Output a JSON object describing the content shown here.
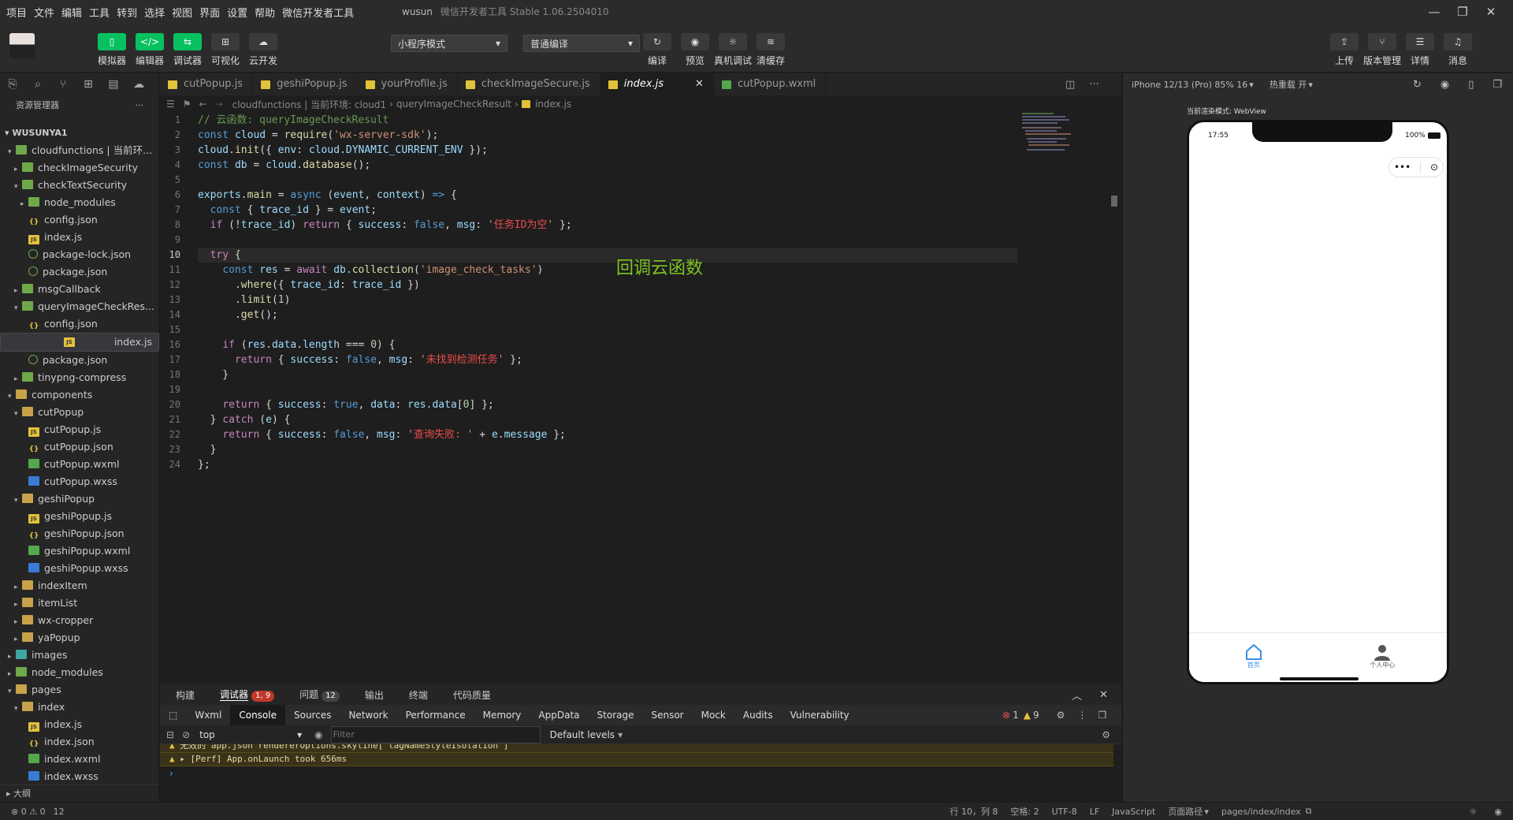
{
  "menu": [
    "项目",
    "文件",
    "编辑",
    "工具",
    "转到",
    "选择",
    "视图",
    "界面",
    "设置",
    "帮助",
    "微信开发者工具"
  ],
  "window": {
    "project": "wusun",
    "title": "微信开发者工具 Stable 1.06.2504010"
  },
  "toolbar": {
    "left": [
      "模拟器",
      "编辑器",
      "调试器",
      "可视化",
      "云开发"
    ],
    "mode_select": "小程序模式",
    "compile_select": "普通编译",
    "mid": [
      "编译",
      "预览",
      "真机调试",
      "清缓存"
    ],
    "right": [
      "上传",
      "版本管理",
      "详情",
      "消息"
    ]
  },
  "explorer": {
    "title": "资源管理器",
    "root": "WUSUNYA1",
    "outline": "大纲",
    "items": [
      {
        "label": "cloudfunctions | 当前环...",
        "icon": "folderg",
        "depth": 1,
        "arrow": "▾"
      },
      {
        "label": "checkImageSecurity",
        "icon": "folderg",
        "depth": 2,
        "arrow": "▸"
      },
      {
        "label": "checkTextSecurity",
        "icon": "folderg",
        "depth": 2,
        "arrow": "▾"
      },
      {
        "label": "node_modules",
        "icon": "folderg",
        "depth": 3,
        "arrow": "▸"
      },
      {
        "label": "config.json",
        "icon": "json",
        "depth": 3,
        "arrow": ""
      },
      {
        "label": "index.js",
        "icon": "js",
        "depth": 3,
        "arrow": ""
      },
      {
        "label": "package-lock.json",
        "icon": "pkg",
        "depth": 3,
        "arrow": ""
      },
      {
        "label": "package.json",
        "icon": "pkg",
        "depth": 3,
        "arrow": ""
      },
      {
        "label": "msgCallback",
        "icon": "folderg",
        "depth": 2,
        "arrow": "▸"
      },
      {
        "label": "queryImageCheckRes...",
        "icon": "folderg",
        "depth": 2,
        "arrow": "▾"
      },
      {
        "label": "config.json",
        "icon": "json",
        "depth": 3,
        "arrow": ""
      },
      {
        "label": "index.js",
        "icon": "js",
        "depth": 3,
        "arrow": "",
        "selected": true
      },
      {
        "label": "package.json",
        "icon": "pkg",
        "depth": 3,
        "arrow": ""
      },
      {
        "label": "tinypng-compress",
        "icon": "folderg",
        "depth": 2,
        "arrow": "▸"
      },
      {
        "label": "components",
        "icon": "folder",
        "depth": 1,
        "arrow": "▾"
      },
      {
        "label": "cutPopup",
        "icon": "folder",
        "depth": 2,
        "arrow": "▾"
      },
      {
        "label": "cutPopup.js",
        "icon": "js",
        "depth": 3,
        "arrow": ""
      },
      {
        "label": "cutPopup.json",
        "icon": "json",
        "depth": 3,
        "arrow": ""
      },
      {
        "label": "cutPopup.wxml",
        "icon": "wxml",
        "depth": 3,
        "arrow": ""
      },
      {
        "label": "cutPopup.wxss",
        "icon": "wxss",
        "depth": 3,
        "arrow": ""
      },
      {
        "label": "geshiPopup",
        "icon": "folder",
        "depth": 2,
        "arrow": "▾"
      },
      {
        "label": "geshiPopup.js",
        "icon": "js",
        "depth": 3,
        "arrow": ""
      },
      {
        "label": "geshiPopup.json",
        "icon": "json",
        "depth": 3,
        "arrow": ""
      },
      {
        "label": "geshiPopup.wxml",
        "icon": "wxml",
        "depth": 3,
        "arrow": ""
      },
      {
        "label": "geshiPopup.wxss",
        "icon": "wxss",
        "depth": 3,
        "arrow": ""
      },
      {
        "label": "indexItem",
        "icon": "folder",
        "depth": 2,
        "arrow": "▸"
      },
      {
        "label": "itemList",
        "icon": "folder",
        "depth": 2,
        "arrow": "▸"
      },
      {
        "label": "wx-cropper",
        "icon": "folder",
        "depth": 2,
        "arrow": "▸"
      },
      {
        "label": "yaPopup",
        "icon": "folder",
        "depth": 2,
        "arrow": "▸"
      },
      {
        "label": "images",
        "icon": "img",
        "depth": 1,
        "arrow": "▸"
      },
      {
        "label": "node_modules",
        "icon": "folderg",
        "depth": 1,
        "arrow": "▸"
      },
      {
        "label": "pages",
        "icon": "folder",
        "depth": 1,
        "arrow": "▾"
      },
      {
        "label": "index",
        "icon": "folder",
        "depth": 2,
        "arrow": "▾"
      },
      {
        "label": "index.js",
        "icon": "js",
        "depth": 3,
        "arrow": ""
      },
      {
        "label": "index.json",
        "icon": "json",
        "depth": 3,
        "arrow": ""
      },
      {
        "label": "index.wxml",
        "icon": "wxml",
        "depth": 3,
        "arrow": ""
      },
      {
        "label": "index.wxss",
        "icon": "wxss",
        "depth": 3,
        "arrow": ""
      }
    ]
  },
  "tabs": [
    {
      "label": "cutPopup.js",
      "icon": "js"
    },
    {
      "label": "geshiPopup.js",
      "icon": "js"
    },
    {
      "label": "yourProfile.js",
      "icon": "js"
    },
    {
      "label": "checkImageSecure.js",
      "icon": "js"
    },
    {
      "label": "index.js",
      "icon": "js",
      "active": true
    },
    {
      "label": "cutPopup.wxml",
      "icon": "wxml"
    }
  ],
  "breadcrumb": [
    "cloudfunctions | 当前环境: cloud1",
    "queryImageCheckResult",
    "index.js"
  ],
  "editor": {
    "current_line": 10,
    "annotation": "回调云函数",
    "lines": [
      "<span class='cm'>// 云函数: queryImageCheckResult</span>",
      "<span class='kb'>const</span> <span class='vr'>cloud</span> = <span class='fn'>require</span>(<span class='str'>'wx-server-sdk'</span>);",
      "<span class='vr'>cloud</span>.<span class='fn'>init</span>({ <span class='prop'>env</span>: <span class='vr'>cloud</span>.<span class='vr'>DYNAMIC_CURRENT_ENV</span> });",
      "<span class='kb'>const</span> <span class='vr'>db</span> = <span class='vr'>cloud</span>.<span class='fn'>database</span>();",
      "",
      "<span class='vr'>exports</span>.<span class='fn'>main</span> = <span class='kb'>async</span> (<span class='vr'>event</span>, <span class='vr'>context</span>) <span class='kb'>=&gt;</span> {",
      "  <span class='kb'>const</span> { <span class='vr'>trace_id</span> } = <span class='vr'>event</span>;",
      "  <span class='kw'>if</span> (!<span class='vr'>trace_id</span>) <span class='kw'>return</span> { <span class='prop'>success</span>: <span class='bo'>false</span>, <span class='prop'>msg</span>: <span class='str'>'</span><span class='cstr'>任务ID为空</span><span class='str'>'</span> };",
      "",
      "  <span class='kw'>try</span> {",
      "    <span class='kb'>const</span> <span class='vr'>res</span> = <span class='kw'>await</span> <span class='vr'>db</span>.<span class='fn'>collection</span>(<span class='str'>'image_check_tasks'</span>)",
      "      .<span class='fn'>where</span>({ <span class='prop'>trace_id</span>: <span class='vr'>trace_id</span> })",
      "      .<span class='fn'>limit</span>(<span class='nm'>1</span>)",
      "      .<span class='fn'>get</span>();",
      "",
      "    <span class='kw'>if</span> (<span class='vr'>res</span>.<span class='vr'>data</span>.<span class='vr'>length</span> === <span class='nm'>0</span>) {",
      "      <span class='kw'>return</span> { <span class='prop'>success</span>: <span class='bo'>false</span>, <span class='prop'>msg</span>: <span class='str'>'</span><span class='cstr'>未找到检测任务</span><span class='str'>'</span> };",
      "    }",
      "",
      "    <span class='kw'>return</span> { <span class='prop'>success</span>: <span class='bo'>true</span>, <span class='prop'>data</span>: <span class='vr'>res</span>.<span class='vr'>data</span>[<span class='nm'>0</span>] };",
      "  } <span class='kw'>catch</span> (<span class='vr'>e</span>) {",
      "    <span class='kw'>return</span> { <span class='prop'>success</span>: <span class='bo'>false</span>, <span class='prop'>msg</span>: <span class='str'>'</span><span class='cstr'>查询失败: </span><span class='str'>'</span> + <span class='vr'>e</span>.<span class='vr'>message</span> };",
      "  }",
      "};"
    ]
  },
  "panel": {
    "tabs": [
      "构建",
      "调试器",
      "问题",
      "输出",
      "终端",
      "代码质量"
    ],
    "debugger_badge": "1, 9",
    "problems_badge": "12",
    "devtools_tabs": [
      "Wxml",
      "Console",
      "Sources",
      "Network",
      "Performance",
      "Memory",
      "AppData",
      "Storage",
      "Sensor",
      "Mock",
      "Audits",
      "Vulnerability"
    ],
    "active_devtab": "Console",
    "errors": "1",
    "warnings": "9",
    "context": "top",
    "filter_placeholder": "Filter",
    "levels": "Default levels",
    "logs": [
      "无效的 app.json rendererOptions.skyline[\"tagNameStyleIsolation\"]",
      "▸ [Perf] App.onLaunch took 656ms"
    ],
    "prompt": "›"
  },
  "simulator": {
    "device": "iPhone 12/13 (Pro) 85% 16",
    "hotreload": "热重载 开",
    "render_mode": "当前渲染模式: WebView",
    "time": "17:55",
    "battery": "100%",
    "tabbar": [
      {
        "label": "首页",
        "icon": "home-icon",
        "active": true
      },
      {
        "label": "个人中心",
        "icon": "user-icon"
      }
    ]
  },
  "statusbar": {
    "problems": "⊗ 0 ⚠ 0",
    "count": "12",
    "position": "行 10，列 8",
    "spaces": "空格: 2",
    "encoding": "UTF-8",
    "eol": "LF",
    "language": "JavaScript",
    "page_path_label": "页面路径",
    "page_path": "pages/index/index"
  }
}
